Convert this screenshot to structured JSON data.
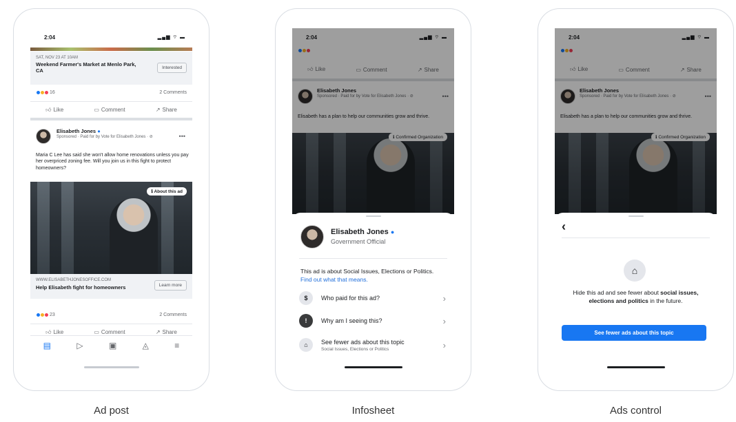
{
  "status": {
    "time": "2:04",
    "icons": "▂▄▆ ⌔ ▬"
  },
  "phone1": {
    "event": {
      "date": "SAT, NOV 23 AT 10AM",
      "title": "Weekend Farmer's Market at Menlo Park, CA",
      "button": "Interested"
    },
    "reactions1": {
      "count": "16",
      "comments": "2 Comments"
    },
    "actions": {
      "like": "Like",
      "comment": "Comment",
      "share": "Share"
    },
    "post": {
      "author": "Elisabeth Jones",
      "sponsored": "Sponsored · Paid for by Vote for Elisabeth Jones · ⊘",
      "body": "Maria C Lee has said she won't allow home renovations unless you pay her overpriced zoning fee. Will you join us in this fight to protect homeowners?",
      "badge": "About this ad",
      "url": "WWW.ELISABETHJONESOFFICE.COM",
      "headline": "Help Elisabeth fight for homeowners",
      "cta": "Learn more"
    },
    "reactions2": {
      "count": "23",
      "comments": "2 Comments"
    }
  },
  "phone2": {
    "author": "Elisabeth Jones",
    "sponsored": "Sponsored · Paid for by Vote for Elisabeth Jones · ⊘",
    "body": "Elisabeth has a plan to help our communities grow and thrive.",
    "badge": "Confirmed Organization",
    "sheet": {
      "name": "Elisabeth Jones",
      "role": "Government Official",
      "about": "This ad is about Social Issues, Elections or Politics. ",
      "about_link": "Find out what that means.",
      "items": [
        {
          "icon": "$",
          "label": "Who paid for this ad?"
        },
        {
          "icon": "!",
          "label": "Why am I seeing this?"
        },
        {
          "icon": "⌂",
          "label": "See fewer ads about this topic",
          "sub": "Social Issues, Elections or Politics"
        }
      ]
    }
  },
  "phone3": {
    "back": "‹",
    "text_pre": "Hide this ad and see fewer about ",
    "text_bold": "social issues, elections and politics",
    "text_post": " in the future.",
    "button": "See fewer ads about this topic"
  },
  "captions": {
    "c1": "Ad post",
    "c2": "Infosheet",
    "c3": "Ads control"
  },
  "colors": {
    "accent": "#1877f2",
    "link": "#216fdb"
  }
}
